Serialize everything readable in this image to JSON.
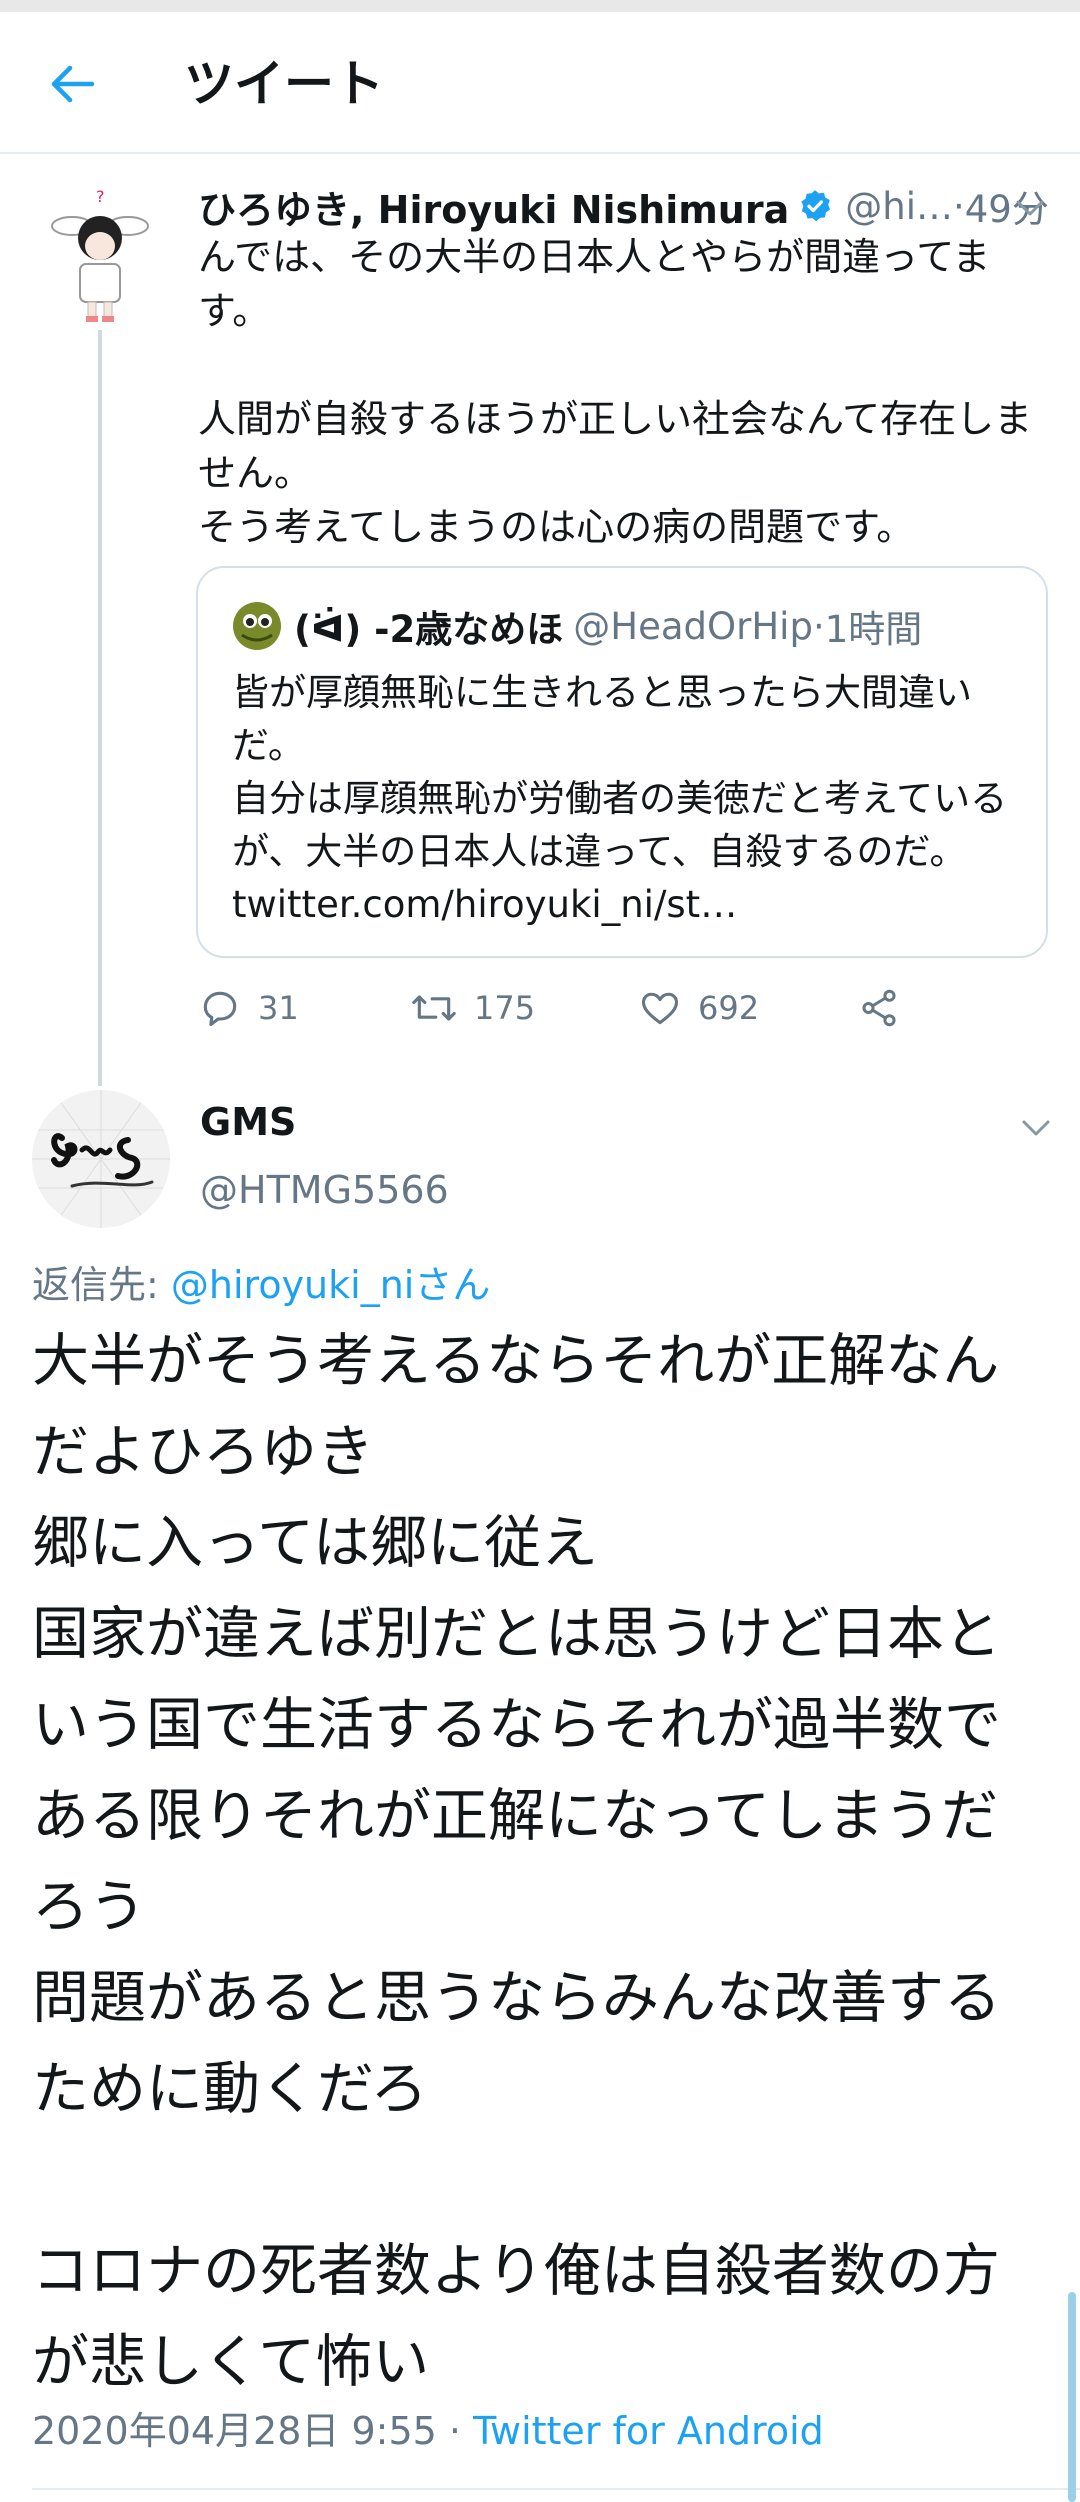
{
  "header": {
    "title": "ツイート"
  },
  "tweet": {
    "author_name": "ひろゆき, Hiroyuki Nishimura",
    "handle": "@hi…",
    "separator": " · ",
    "time": "49分",
    "body": "んでは、その大半の日本人とやらが間違ってます。\n\n人間が自殺するほうが正しい社会なんて存在しません。\nそう考えてしまうのは心の病の問題です。",
    "quote": {
      "author_name": "(ᐛ) -2歳なめほ",
      "handle": "@HeadOrHip",
      "separator": " · ",
      "time": "1時間",
      "body": "皆が厚顔無恥に生きれると思ったら大間違いだ。\n自分は厚顔無恥が労働者の美徳だと考えているが、大半の日本人は違って、自殺するのだ。 twitter.com/hiroyuki_ni/st…"
    },
    "actions": {
      "replies": "31",
      "retweets": "175",
      "likes": "692"
    }
  },
  "reply": {
    "author_name": "GMS",
    "handle": "@HTMG5566",
    "reply_to_prefix": "返信先: ",
    "reply_to_mention": "@hiroyuki_niさん",
    "body": "大半がそう考えるならそれが正解なんだよひろゆき\n郷に入っては郷に従え\n国家が違えば別だとは思うけど日本という国で生活するならそれが過半数である限りそれが正解になってしまうだろう\n問題があると思うならみんな改善するために動くだろ\n\nコロナの死者数より俺は自殺者数の方が悲しくて怖い",
    "timestamp": "2020年04月28日 9:55",
    "meta_separator": " · ",
    "client": "Twitter for Android"
  },
  "colors": {
    "accent": "#1da1f2",
    "secondary_text": "#657786",
    "text": "#14171a"
  }
}
